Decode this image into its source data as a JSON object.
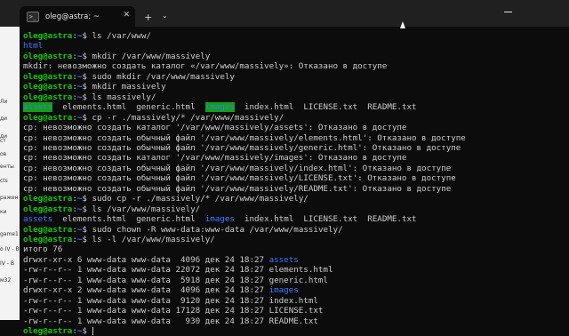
{
  "tab": {
    "title": "oleg@astra: ~",
    "icon": ">_",
    "close": "✕",
    "add": "+",
    "dropdown": "⌄"
  },
  "background_window": {
    "fragments": [
      "Ли",
      "ди",
      "ди",
      "ст",
      "ов",
      "енты",
      "cts",
      "ражен",
      "ки",
      "game1",
      "o IV - B",
      "IV - B",
      "м32"
    ]
  },
  "prompt": {
    "user": "oleg@astra",
    "sep": ":",
    "path": "~",
    "symbol": "$ "
  },
  "lines": [
    {
      "type": "cmd",
      "text": "ls /var/www/"
    },
    {
      "type": "dirs",
      "items": [
        "html"
      ]
    },
    {
      "type": "cmd",
      "text": "mkdir /var/www/massively"
    },
    {
      "type": "out",
      "text": "mkdir: невозможно создать каталог «/var/www/massively»: Отказано в доступе"
    },
    {
      "type": "cmd",
      "text": "sudo mkdir /var/www/massively"
    },
    {
      "type": "cmd",
      "text": "mkdir massively"
    },
    {
      "type": "cmd",
      "text": "ls massively/"
    },
    {
      "type": "ls",
      "items": [
        {
          "t": "assets",
          "k": "dirhl"
        },
        {
          "t": "  elements.html  generic.html  ",
          "k": ""
        },
        {
          "t": "images",
          "k": "dirhl"
        },
        {
          "t": "  index.html  LICENSE.txt  README.txt",
          "k": ""
        }
      ]
    },
    {
      "type": "cmd",
      "text": "cp -r ./massively/* /var/www/massively/"
    },
    {
      "type": "out",
      "text": "cp: невозможно создать каталог '/var/www/massively/assets': Отказано в доступе"
    },
    {
      "type": "out",
      "text": "cp: невозможно создать обычный файл '/var/www/massively/elements.html': Отказано в доступе"
    },
    {
      "type": "out",
      "text": "cp: невозможно создать обычный файл '/var/www/massively/generic.html': Отказано в доступе"
    },
    {
      "type": "out",
      "text": "cp: невозможно создать каталог '/var/www/massively/images': Отказано в доступе"
    },
    {
      "type": "out",
      "text": "cp: невозможно создать обычный файл '/var/www/massively/index.html': Отказано в доступе"
    },
    {
      "type": "out",
      "text": "cp: невозможно создать обычный файл '/var/www/massively/LICENSE.txt': Отказано в доступе"
    },
    {
      "type": "out",
      "text": "cp: невозможно создать обычный файл '/var/www/massively/README.txt': Отказано в доступе"
    },
    {
      "type": "cmd",
      "text": "sudo cp -r ./massively/* /var/www/massively/"
    },
    {
      "type": "cmd",
      "text": "ls /var/www/massively/"
    },
    {
      "type": "ls",
      "items": [
        {
          "t": "assets",
          "k": "dir"
        },
        {
          "t": "  elements.html  generic.html  ",
          "k": ""
        },
        {
          "t": "images",
          "k": "dir"
        },
        {
          "t": "  index.html  LICENSE.txt  README.txt",
          "k": ""
        }
      ]
    },
    {
      "type": "cmd",
      "text": "sudo chown -R www-data:www-data /var/www/massively/"
    },
    {
      "type": "cmd",
      "text": "ls -l /var/www/massively/"
    },
    {
      "type": "out",
      "text": "итого 76"
    },
    {
      "type": "ls",
      "items": [
        {
          "t": "drwxr-xr-x 6 www-data www-data  4096 дек 24 18:27 ",
          "k": ""
        },
        {
          "t": "assets",
          "k": "dir"
        }
      ]
    },
    {
      "type": "out",
      "text": "-rw-r--r-- 1 www-data www-data 22072 дек 24 18:27 elements.html"
    },
    {
      "type": "out",
      "text": "-rw-r--r-- 1 www-data www-data  5918 дек 24 18:27 generic.html"
    },
    {
      "type": "ls",
      "items": [
        {
          "t": "drwxr-xr-x 2 www-data www-data  4096 дек 24 18:27 ",
          "k": ""
        },
        {
          "t": "images",
          "k": "dir"
        }
      ]
    },
    {
      "type": "out",
      "text": "-rw-r--r-- 1 www-data www-data  9120 дек 24 18:27 index.html"
    },
    {
      "type": "out",
      "text": "-rw-r--r-- 1 www-data www-data 17128 дек 24 18:27 LICENSE.txt"
    },
    {
      "type": "out",
      "text": "-rw-r--r-- 1 www-data www-data   930 дек 24 18:27 README.txt"
    },
    {
      "type": "cmd",
      "text": "",
      "cursor": true
    }
  ],
  "colors": {
    "background": "#0c0c0c",
    "text": "#cccccc",
    "prompt_user": "#16c60c",
    "prompt_path": "#3b78ff",
    "directory": "#3b78ff",
    "highlight_bg": "#13a10e"
  }
}
